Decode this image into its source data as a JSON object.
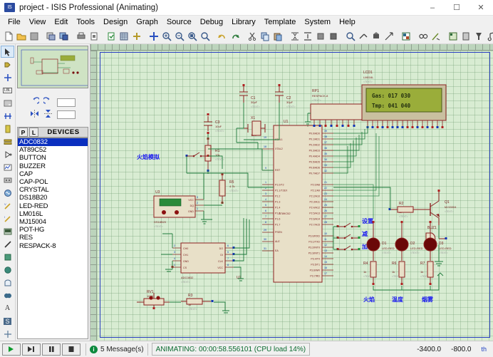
{
  "window": {
    "title": "project - ISIS Professional (Animating)",
    "icon_name": "isis-app-icon",
    "icon_text": "IS",
    "minimize": "–",
    "maximize": "☐",
    "close": "✕"
  },
  "menubar": {
    "items": [
      {
        "label": "File"
      },
      {
        "label": "View"
      },
      {
        "label": "Edit"
      },
      {
        "label": "Tools"
      },
      {
        "label": "Design"
      },
      {
        "label": "Graph"
      },
      {
        "label": "Source"
      },
      {
        "label": "Debug"
      },
      {
        "label": "Library"
      },
      {
        "label": "Template"
      },
      {
        "label": "System"
      },
      {
        "label": "Help"
      }
    ]
  },
  "toolbar": {
    "groups": [
      [
        "new-file-icon",
        "open-file-icon",
        "save-file-icon"
      ],
      [
        "import-section-icon",
        "export-section-icon"
      ],
      [
        "print-icon",
        "print-region-icon"
      ],
      [
        "refresh-display-icon",
        "toggle-grid-icon",
        "origin-icon"
      ],
      [
        "pan-icon",
        "zoom-in-icon",
        "zoom-out-icon",
        "zoom-area-icon",
        "zoom-all-icon"
      ],
      [
        "undo-icon",
        "redo-icon"
      ],
      [
        "cut-icon",
        "copy-icon",
        "paste-icon"
      ],
      [
        "block-copy-icon",
        "block-move-icon",
        "block-rotate-icon",
        "block-delete-icon"
      ],
      [
        "pick-device-icon",
        "make-device-icon",
        "package-tool-icon",
        "release-device-icon"
      ],
      [
        "netlist-icon"
      ],
      [
        "electrical-rules-icon",
        "netlist-compiler-icon"
      ],
      [
        "bill-of-materials-icon",
        "ares-icon",
        "3d-viewer-icon",
        "design-explorer-icon"
      ],
      [
        "new-sheet-icon",
        "remove-sheet-icon"
      ],
      [
        "exit-sheet-icon"
      ]
    ]
  },
  "modebar": {
    "items": [
      {
        "name": "selection-mode-icon",
        "glyph": "➤",
        "active": true
      },
      {
        "name": "component-mode-icon",
        "glyph": "▷",
        "active": false
      },
      {
        "name": "junction-dot-mode-icon",
        "glyph": "✚",
        "active": false
      },
      {
        "name": "wire-label-mode-icon",
        "glyph": "LBL",
        "active": false
      },
      {
        "name": "text-script-mode-icon",
        "glyph": "≡",
        "active": false
      },
      {
        "name": "bus-mode-icon",
        "glyph": "┣",
        "active": false
      },
      {
        "name": "subcircuit-mode-icon",
        "glyph": "⬛",
        "active": false
      },
      {
        "name": "terminals-mode-icon",
        "glyph": "▭",
        "active": false
      },
      {
        "name": "device-pin-mode-icon",
        "glyph": "⊳",
        "active": false
      },
      {
        "name": "graph-mode-icon",
        "glyph": "∵",
        "active": false
      },
      {
        "name": "tape-recorder-mode-icon",
        "glyph": "▤",
        "active": false
      },
      {
        "name": "generator-mode-icon",
        "glyph": "◎",
        "active": false
      },
      {
        "name": "voltage-probe-mode-icon",
        "glyph": "V",
        "active": false
      },
      {
        "name": "current-probe-mode-icon",
        "glyph": "I",
        "active": false
      },
      {
        "name": "virtual-instruments-mode-icon",
        "glyph": "▦",
        "active": false
      },
      {
        "name": "2d-line-icon",
        "glyph": "╱",
        "active": false
      },
      {
        "name": "2d-box-icon",
        "glyph": "■",
        "active": false
      },
      {
        "name": "2d-circle-icon",
        "glyph": "●",
        "active": false
      },
      {
        "name": "2d-arc-icon",
        "glyph": "◖",
        "active": false
      },
      {
        "name": "2d-path-icon",
        "glyph": "◑",
        "active": false
      },
      {
        "name": "2d-text-icon",
        "glyph": "A",
        "active": false
      },
      {
        "name": "2d-symbol-icon",
        "glyph": "S",
        "active": false
      },
      {
        "name": "2d-marker-icon",
        "glyph": "✢",
        "active": false
      }
    ]
  },
  "leftpanel": {
    "preview_name": "schematic-overview-preview",
    "rotation_label": "rotation-controls",
    "devices_header": {
      "p_button": "P",
      "l_button": "L",
      "title": "DEVICES"
    },
    "devices": [
      {
        "label": "ADC0832",
        "selected": true
      },
      {
        "label": "AT89C52",
        "selected": false
      },
      {
        "label": "BUTTON",
        "selected": false
      },
      {
        "label": "BUZZER",
        "selected": false
      },
      {
        "label": "CAP",
        "selected": false
      },
      {
        "label": "CAP-POL",
        "selected": false
      },
      {
        "label": "CRYSTAL",
        "selected": false
      },
      {
        "label": "DS18B20",
        "selected": false
      },
      {
        "label": "LED-RED",
        "selected": false
      },
      {
        "label": "LM016L",
        "selected": false
      },
      {
        "label": "MJ15004",
        "selected": false
      },
      {
        "label": "POT-HG",
        "selected": false
      },
      {
        "label": "RES",
        "selected": false
      },
      {
        "label": "RESPACK-8",
        "selected": false
      }
    ]
  },
  "schematic": {
    "lcd": {
      "ref": "LCD1",
      "value": "LM016L",
      "device_tag": "<TEXT>",
      "line1": "Gas: 017    030",
      "line2": "Tmp: 041    040"
    },
    "mcu": {
      "ref": "U1",
      "value": "AT89C52",
      "port0": [
        "P0.0/AD0",
        "P0.1/AD1",
        "P0.2/AD2",
        "P0.3/AD3",
        "P0.4/AD4",
        "P0.5/AD5",
        "P0.6/AD6",
        "P0.7/AD7"
      ],
      "port0_pins": [
        "39",
        "38",
        "37",
        "36",
        "35",
        "34",
        "33",
        "32"
      ],
      "port2": [
        "P2.0/A8",
        "P2.1/A9",
        "P2.2/A10",
        "P2.3/A11",
        "P2.4/A12",
        "P2.5/A13",
        "P2.6/A14",
        "P2.7/A15"
      ],
      "port2_pins": [
        "21",
        "22",
        "23",
        "24",
        "25",
        "26",
        "27",
        "28"
      ],
      "port3": [
        "P3.0/RXD",
        "P3.1/TXD",
        "P3.2/INT0",
        "P3.3/INT1",
        "P3.4/T0",
        "P3.5/T1",
        "P3.6/WR",
        "P3.7/RD"
      ],
      "port3_pins": [
        "10",
        "11",
        "12",
        "13",
        "14",
        "15",
        "16",
        "17"
      ],
      "port1": [
        "P1.0/T2",
        "P1.1/T2EX",
        "P1.2",
        "P1.3",
        "P1.4",
        "P1.5",
        "P1.6",
        "P1.7"
      ],
      "port1_pins": [
        "1",
        "2",
        "3",
        "4",
        "5",
        "6",
        "7",
        "8"
      ],
      "left_pins": [
        {
          "label": "XTAL1",
          "num": "19"
        },
        {
          "label": "XTAL2",
          "num": "18"
        },
        {
          "label": "RST",
          "num": "9"
        },
        {
          "label": "PSEN",
          "num": "29"
        },
        {
          "label": "ALE",
          "num": "30"
        },
        {
          "label": "EA",
          "num": "31"
        }
      ]
    },
    "components": [
      {
        "ref": "C1",
        "value": "30pF",
        "tag": "<TEXT>"
      },
      {
        "ref": "C2",
        "value": "30pF",
        "tag": "<TEXT>"
      },
      {
        "ref": "C3",
        "value": "10uF",
        "tag": "<TEXT>"
      },
      {
        "ref": "X1",
        "value": "12M",
        "tag": "<TEXT>"
      },
      {
        "ref": "R1",
        "value": "10k",
        "tag": "<TEXT>"
      },
      {
        "ref": "R2",
        "value": "1k",
        "tag": "<TEXT>"
      },
      {
        "ref": "R3",
        "value": "1k",
        "tag": "<TEXT>"
      },
      {
        "ref": "R4",
        "value": "1k",
        "tag": "<TEXT>"
      },
      {
        "ref": "R6",
        "value": "1k",
        "tag": "<TEXT>"
      },
      {
        "ref": "R7",
        "value": "1k",
        "tag": "<TEXT>"
      },
      {
        "ref": "R5",
        "value": "4.7k",
        "tag": "<TEXT>"
      },
      {
        "ref": "RP1",
        "value": "RESPACK-8",
        "tag": "<TEXT>"
      },
      {
        "ref": "RV1",
        "value": "100K",
        "tag": "<TEXT>"
      },
      {
        "ref": "Q1",
        "value": "MJ15004",
        "tag": "<TEXT>"
      },
      {
        "ref": "BUZ1",
        "value": "BUZZER",
        "tag": "<TEXT>"
      },
      {
        "ref": "D1",
        "value": "LED-RED",
        "tag": "<TEXT>"
      },
      {
        "ref": "D2",
        "value": "LED-RED",
        "tag": "<TEXT>"
      },
      {
        "ref": "D3",
        "value": "LED-RED",
        "tag": "<TEXT>"
      },
      {
        "ref": "U2",
        "value": "ADC0832",
        "tag": "<TEXT>"
      },
      {
        "ref": "U3",
        "value": "DS18B20",
        "tag": "<TEXT>"
      }
    ],
    "annotations": [
      {
        "name": "flame-sim-label",
        "text": "火焰模拟"
      },
      {
        "name": "set-button-label",
        "text": "设置"
      },
      {
        "name": "minus-button-label",
        "text": "减"
      },
      {
        "name": "plus-button-label",
        "text": "加"
      },
      {
        "name": "flame-led-label",
        "text": "火焰"
      },
      {
        "name": "temp-led-label",
        "text": "温度"
      },
      {
        "name": "smoke-led-label",
        "text": "烟雾"
      }
    ],
    "adc_pins": {
      "left": [
        "CH0",
        "CH1",
        "GND",
        "CS"
      ],
      "left_nums": [
        "2",
        "3",
        "4",
        "1"
      ],
      "right": [
        "DO",
        "DI",
        "CLK",
        "VCC"
      ],
      "right_nums": [
        "6",
        "5",
        "7",
        "8"
      ]
    },
    "ds18b20_pins": {
      "right": [
        "VCC",
        "DQ",
        "GND"
      ],
      "right_nums": [
        "3",
        "2",
        "1"
      ]
    }
  },
  "statusbar": {
    "play_icon": "play-button",
    "step_icon": "step-button",
    "pause_icon": "pause-button",
    "stop_icon": "stop-button",
    "messages": "5 Message(s)",
    "animating": "ANIMATING: 00:00:58.556101 (CPU load 14%)",
    "coord_x": "-3400.0",
    "coord_y": "-800.0",
    "coord_unit": "th"
  },
  "colors": {
    "lcd_screen": "#9aad3a",
    "schematic_bg": "#d8ecd2",
    "component_body": "#e8e0c8",
    "component_outline": "#8b2020",
    "wire": "#1d7a3a",
    "annotation_blue": "#1a1af0",
    "selected_row": "#0a2fbf",
    "animating_green": "#0a6b2f"
  }
}
